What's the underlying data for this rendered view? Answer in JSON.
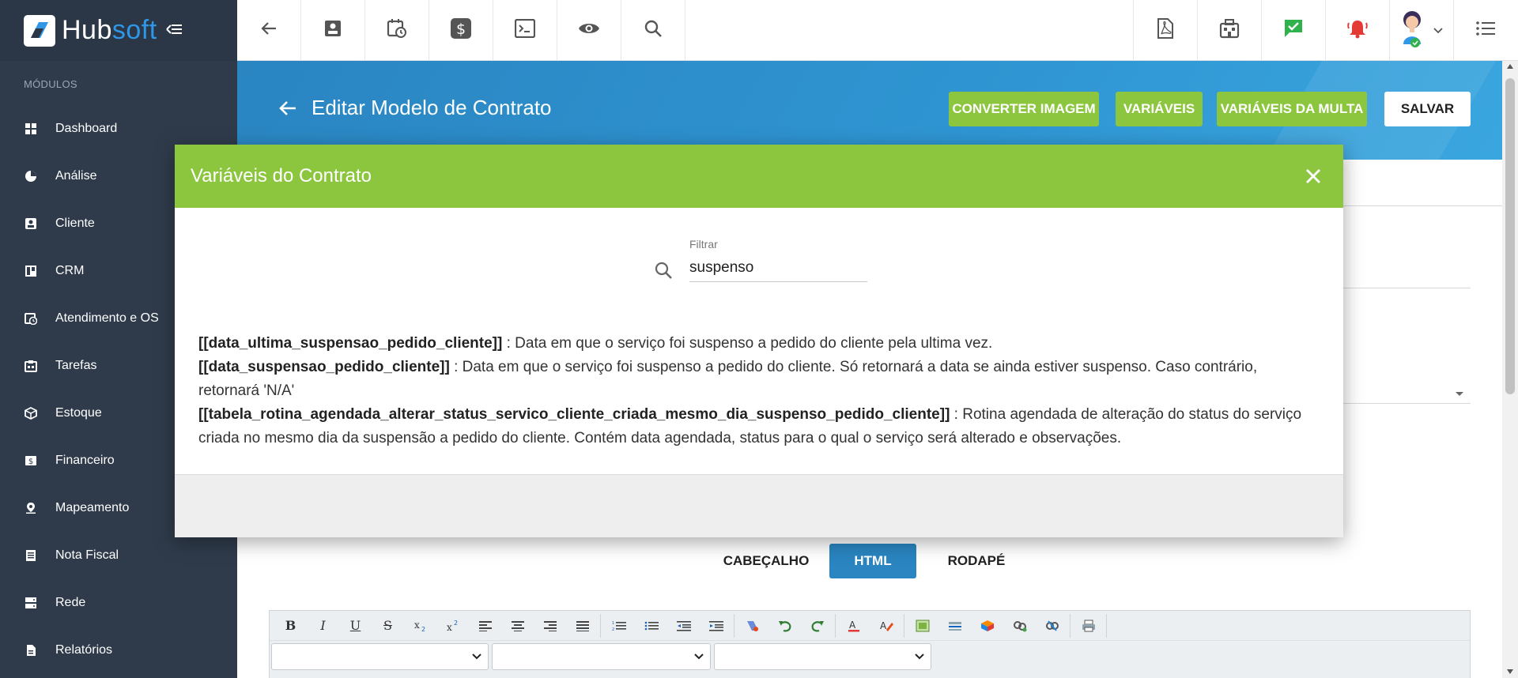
{
  "brand": {
    "name_part1": "Hub",
    "name_part2": "soft"
  },
  "sidebar": {
    "section_title": "MÓDULOS",
    "items": [
      {
        "label": "Dashboard",
        "icon": "dashboard-icon"
      },
      {
        "label": "Análise",
        "icon": "pie-chart-icon"
      },
      {
        "label": "Cliente",
        "icon": "contact-card-icon"
      },
      {
        "label": "CRM",
        "icon": "crm-board-icon"
      },
      {
        "label": "Atendimento e OS",
        "icon": "calendar-clock-icon"
      },
      {
        "label": "Tarefas",
        "icon": "tasks-icon"
      },
      {
        "label": "Estoque",
        "icon": "box-icon"
      },
      {
        "label": "Financeiro",
        "icon": "money-icon"
      },
      {
        "label": "Mapeamento",
        "icon": "map-pin-icon"
      },
      {
        "label": "Nota Fiscal",
        "icon": "invoice-icon"
      },
      {
        "label": "Rede",
        "icon": "server-icon"
      },
      {
        "label": "Relatórios",
        "icon": "report-icon"
      }
    ]
  },
  "header": {
    "title": "Editar Modelo de Contrato",
    "buttons": {
      "convert": "CONVERTER IMAGEM",
      "variables": "VARIÁVEIS",
      "fine_variables": "VARIÁVEIS DA MULTA",
      "save": "SALVAR"
    }
  },
  "tabs": {
    "header": "CABEÇALHO",
    "html": "HTML",
    "footer": "RODAPÉ"
  },
  "modal": {
    "title": "Variáveis do Contrato",
    "filter_label": "Filtrar",
    "filter_value": "suspenso",
    "variables": [
      {
        "name": "[[data_ultima_suspensao_pedido_cliente]]",
        "desc": " : Data em que o serviço foi suspenso a pedido do cliente pela ultima vez."
      },
      {
        "name": "[[data_suspensao_pedido_cliente]]",
        "desc": " : Data em que o serviço foi suspenso a pedido do cliente. Só retornará a data se ainda estiver suspenso. Caso contrário, retornará 'N/A'"
      },
      {
        "name": "[[tabela_rotina_agendada_alterar_status_servico_cliente_criada_mesmo_dia_suspenso_pedido_cliente]]",
        "desc": " : Rotina agendada de alteração do status do serviço criada no mesmo dia da suspensão a pedido do cliente. Contém data agendada, status para o qual o serviço será alterado e observações."
      }
    ]
  },
  "colors": {
    "sidebar_bg": "#2f3b4b",
    "accent_green": "#8cc63f",
    "accent_blue": "#2a85c1",
    "brand_blue": "#2f97e6",
    "notification_red": "#e53935",
    "status_green": "#2fb24c"
  }
}
